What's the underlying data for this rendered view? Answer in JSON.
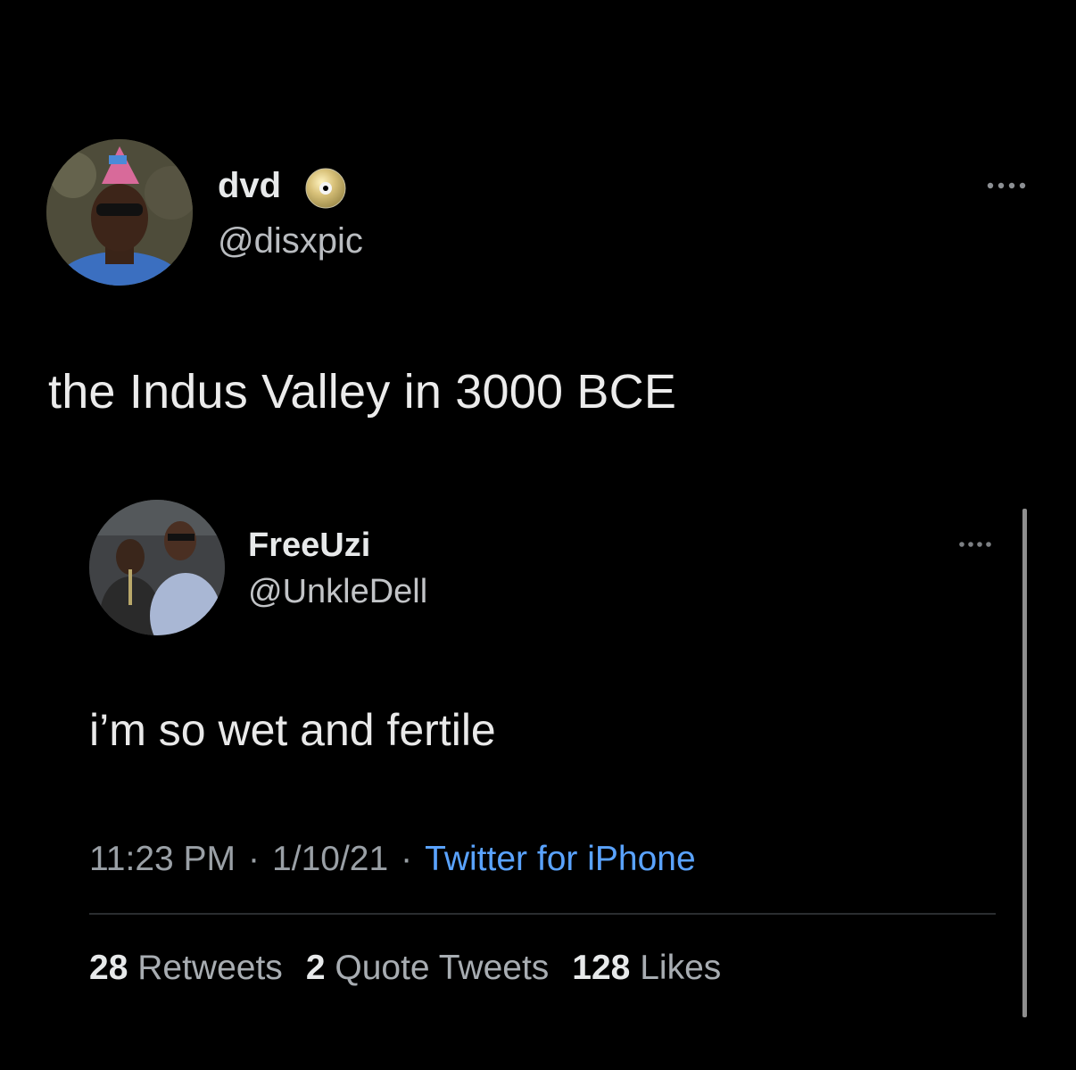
{
  "tweet": {
    "author": {
      "display_name": "dvd",
      "handle": "@disxpic",
      "badge_icon": "cd-disc-icon",
      "avatar_icon": "person-avatar"
    },
    "text": "the Indus Valley in 3000 BCE",
    "more_icon": "more-dots-icon"
  },
  "quoted_tweet": {
    "author": {
      "display_name": "FreeUzi",
      "handle": "@UnkleDell",
      "avatar_icon": "two-people-avatar"
    },
    "text": "i’m so wet and fertile",
    "time": "11:23 PM",
    "date": "1/10/21",
    "separator": "·",
    "source": "Twitter for iPhone",
    "more_icon": "more-dots-icon",
    "stats": {
      "retweets_count": "28",
      "retweets_label": "Retweets",
      "quotes_count": "2",
      "quotes_label": "Quote Tweets",
      "likes_count": "128",
      "likes_label": "Likes"
    }
  },
  "colors": {
    "background": "#000000",
    "link": "#5aa3ff",
    "text_primary": "#e7e9ea",
    "text_secondary": "#9aa0a6"
  }
}
